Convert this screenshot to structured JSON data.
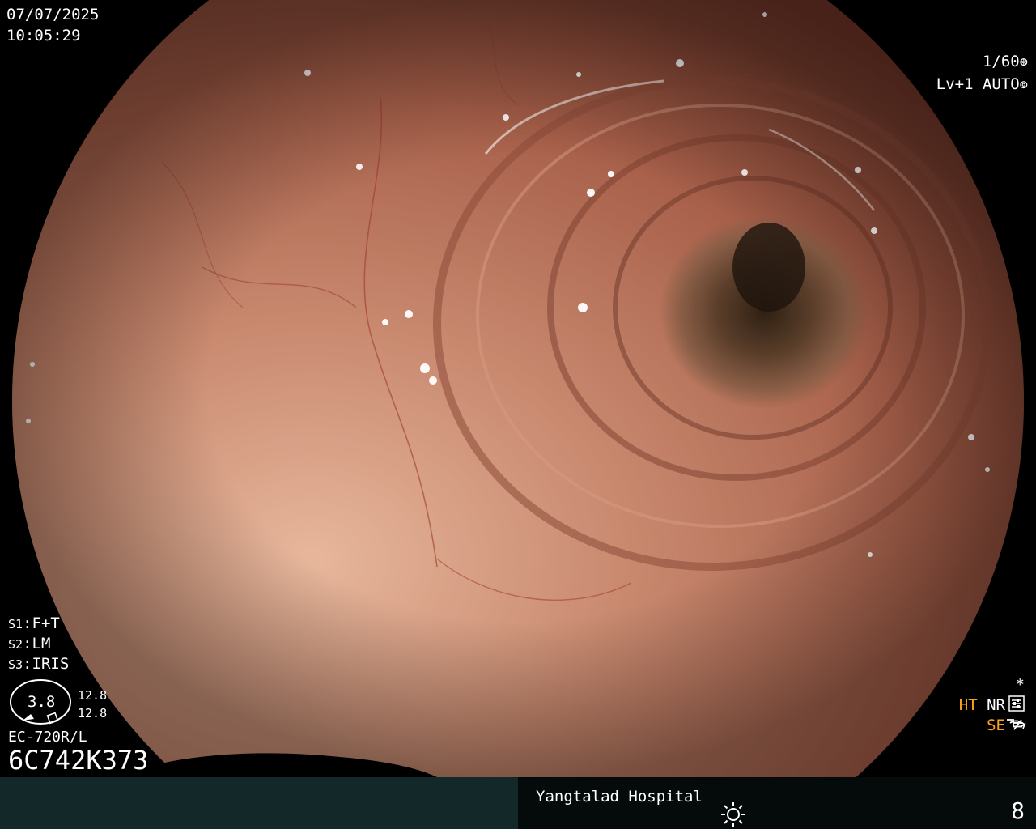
{
  "overlay": {
    "date": "07/07/2025",
    "time": "10:05:29",
    "shutter": "1/60",
    "level": "Lv+1",
    "exposure_mode": "AUTO",
    "switches": [
      {
        "key": "S1",
        "value": "F+T"
      },
      {
        "key": "S2",
        "value": "LM"
      },
      {
        "key": "S3",
        "value": "IRIS"
      }
    ],
    "zoom_gauge": {
      "center": "3.8",
      "upper": "12.8",
      "lower": "12.8"
    },
    "scope_model": "EC-720R/L",
    "serial": "6C742K373",
    "modes": {
      "star": "*",
      "ht": "HT",
      "nr": "NR",
      "se": "SE"
    }
  },
  "footer": {
    "hospital": "Yangtalad Hospital",
    "count": "8"
  },
  "icons": {
    "shutter_icon": "aperture-icon",
    "auto_icon": "iris-icon",
    "menu_icon": "settings-sliders-icon",
    "se_icon": "enhance-curve-icon",
    "not_equal_icon": "not-equal-icon",
    "brightness_icon": "sun-icon"
  },
  "colors": {
    "mucosa": "#b8705a",
    "lumen": "#3a2418",
    "bar_left": "#132929",
    "highlight_orange": "#ffa31a"
  }
}
